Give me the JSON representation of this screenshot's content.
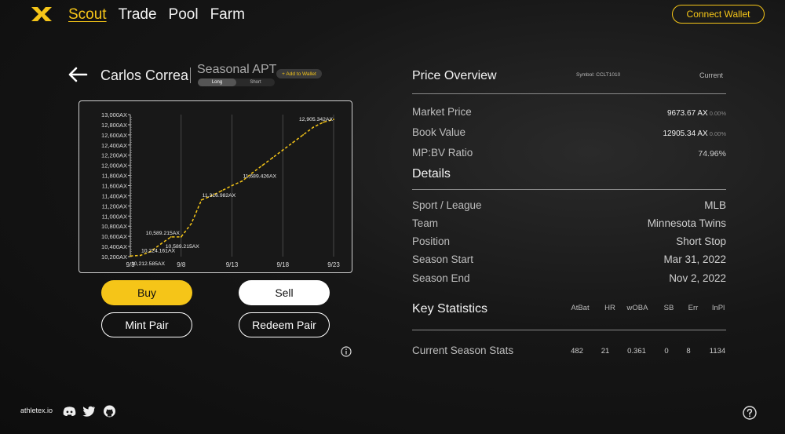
{
  "nav": {
    "items": [
      "Scout",
      "Trade",
      "Pool",
      "Farm"
    ],
    "active": "Scout",
    "connect_label": "Connect Wallet"
  },
  "player": {
    "name": "Carlos Correa",
    "contract": "Seasonal APT",
    "add_wallet_label": "+ Add to Wallet",
    "toggle": [
      "Long",
      "Short"
    ],
    "toggle_selected": "Long"
  },
  "actions": {
    "buy": "Buy",
    "sell": "Sell",
    "mint": "Mint Pair",
    "redeem": "Redeem Pair"
  },
  "price_overview": {
    "title": "Price Overview",
    "symbol": "Symbol: CCLT1010",
    "current_label": "Current",
    "rows": [
      {
        "label": "Market Price",
        "value": "9673.67 AX",
        "change": "0.00%"
      },
      {
        "label": "Book Value",
        "value": "12905.34 AX",
        "change": "0.00%"
      },
      {
        "label": "MP:BV Ratio",
        "value": "74.96%"
      }
    ]
  },
  "details": {
    "title": "Details",
    "rows": [
      {
        "label": "Sport / League",
        "value": "MLB"
      },
      {
        "label": "Team",
        "value": "Minnesota Twins"
      },
      {
        "label": "Position",
        "value": "Short Stop"
      },
      {
        "label": "Season Start",
        "value": "Mar 31, 2022"
      },
      {
        "label": "Season End",
        "value": "Nov 2, 2022"
      }
    ]
  },
  "key_stats": {
    "title": "Key Statistics",
    "columns": [
      "AtBat",
      "HR",
      "wOBA",
      "SB",
      "Err",
      "InPl"
    ],
    "row_label": "Current Season Stats",
    "values": [
      "482",
      "21",
      "0.361",
      "0",
      "8",
      "1134"
    ]
  },
  "footer": {
    "site": "athletex.io"
  },
  "icons": {
    "logo": "athletex-logo-icon",
    "back": "arrow-left-icon",
    "info": "info-icon",
    "discord": "discord-icon",
    "twitter": "twitter-icon",
    "github": "github-icon",
    "help": "help-icon"
  },
  "colors": {
    "accent": "#f5c518",
    "background": "#161616"
  },
  "chart_data": {
    "type": "line",
    "x": [
      "9/3",
      "9/4",
      "9/5",
      "9/6",
      "9/7",
      "9/8",
      "9/9",
      "9/10",
      "9/11",
      "9/12",
      "9/13",
      "9/14",
      "9/15",
      "9/16",
      "9/17",
      "9/18",
      "9/19",
      "9/20",
      "9/21",
      "9/22",
      "9/23"
    ],
    "values": [
      10212.585,
      10224.161,
      10300,
      10450,
      10589.215,
      10589.215,
      10850,
      11316.982,
      11400,
      11500,
      11600,
      11689.426,
      11850,
      12000,
      12150,
      12300,
      12450,
      12600,
      12750,
      12850,
      12905.342
    ],
    "xticks": [
      "9/3",
      "9/8",
      "9/13",
      "9/18",
      "9/23"
    ],
    "yticks": [
      "10,200AX",
      "10,400AX",
      "10,600AX",
      "10,800AX",
      "11,000AX",
      "11,200AX",
      "11,400AX",
      "11,600AX",
      "11,800AX",
      "12,000AX",
      "12,200AX",
      "12,400AX",
      "12,600AX",
      "12,800AX",
      "13,000AX"
    ],
    "ylim": [
      10200,
      13000
    ],
    "annotations": [
      {
        "x": "9/3",
        "text": "10,212.585AX"
      },
      {
        "x": "9/4",
        "text": "10,224.161AX"
      },
      {
        "x": "9/7",
        "text": "10,589.215AX"
      },
      {
        "x": "9/8",
        "text": "10,589.215AX"
      },
      {
        "x": "9/10",
        "text": "11,316.982AX"
      },
      {
        "x": "9/14",
        "text": "11,689.426AX"
      },
      {
        "x": "9/23",
        "text": "12,905.342AX"
      }
    ],
    "grid": "vertical",
    "line_color": "#f5c518"
  }
}
